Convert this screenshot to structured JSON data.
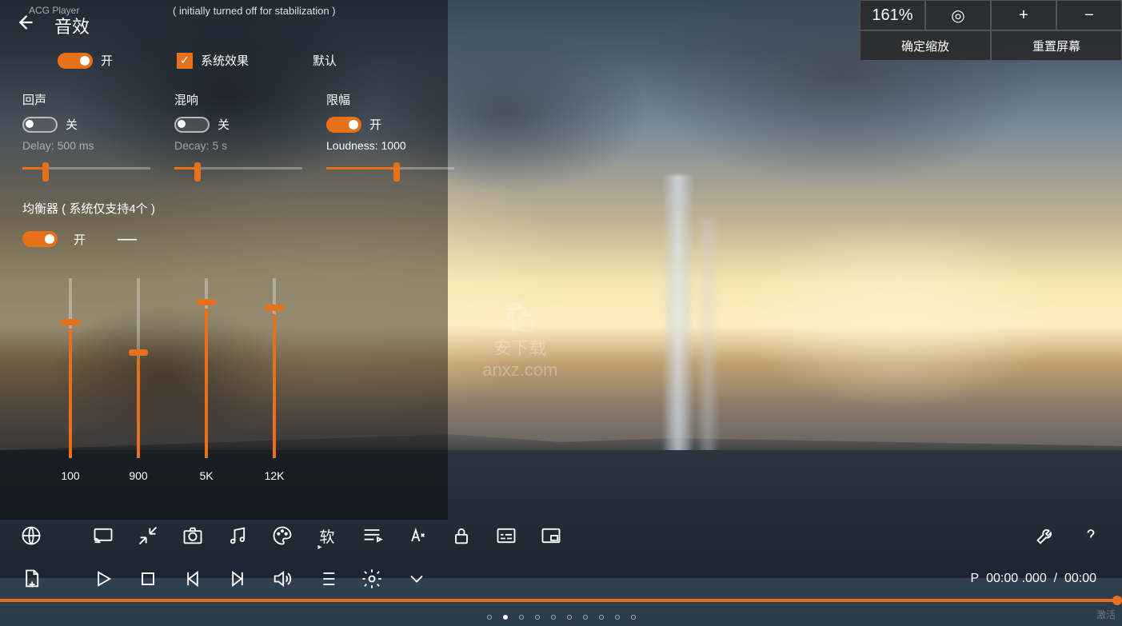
{
  "app_title": "ACG Player",
  "stabilization_note": "( initially turned off for stabilization )",
  "panel": {
    "title": "音效",
    "main_toggle": {
      "state": "on",
      "label": "开"
    },
    "system_effect": {
      "checked": true,
      "label": "系统效果"
    },
    "default_label": "默认",
    "effects": {
      "echo": {
        "title": "回声",
        "state": "off",
        "label": "关",
        "caption": "Delay: 500 ms",
        "slider": 18
      },
      "reverb": {
        "title": "混响",
        "state": "off",
        "label": "关",
        "caption": "Decay: 5 s",
        "slider": 18
      },
      "limiter": {
        "title": "限幅",
        "state": "on",
        "label": "开",
        "caption": "Loudness: 1000",
        "slider": 55
      }
    },
    "equalizer": {
      "title": "均衡器 ( 系统仅支持4个 )",
      "state": "on",
      "label": "开",
      "bands": [
        {
          "hz": "100",
          "pos": 72
        },
        {
          "hz": "900",
          "pos": 55
        },
        {
          "hz": "5K",
          "pos": 83
        },
        {
          "hz": "12K",
          "pos": 80
        }
      ]
    }
  },
  "top_right": {
    "zoom": "161%",
    "confirm_zoom": "确定缩放",
    "reset_screen": "重置屏幕"
  },
  "toolbar": {
    "soft_label": "软",
    "time_prefix": "P",
    "time_elapsed": "00:00 .000",
    "time_sep": "/",
    "time_total": "00:00"
  },
  "pagination": {
    "total": 10,
    "active": 1
  },
  "activate_text": "激活",
  "watermark": {
    "site": "anxz.com",
    "han": "安下载"
  }
}
